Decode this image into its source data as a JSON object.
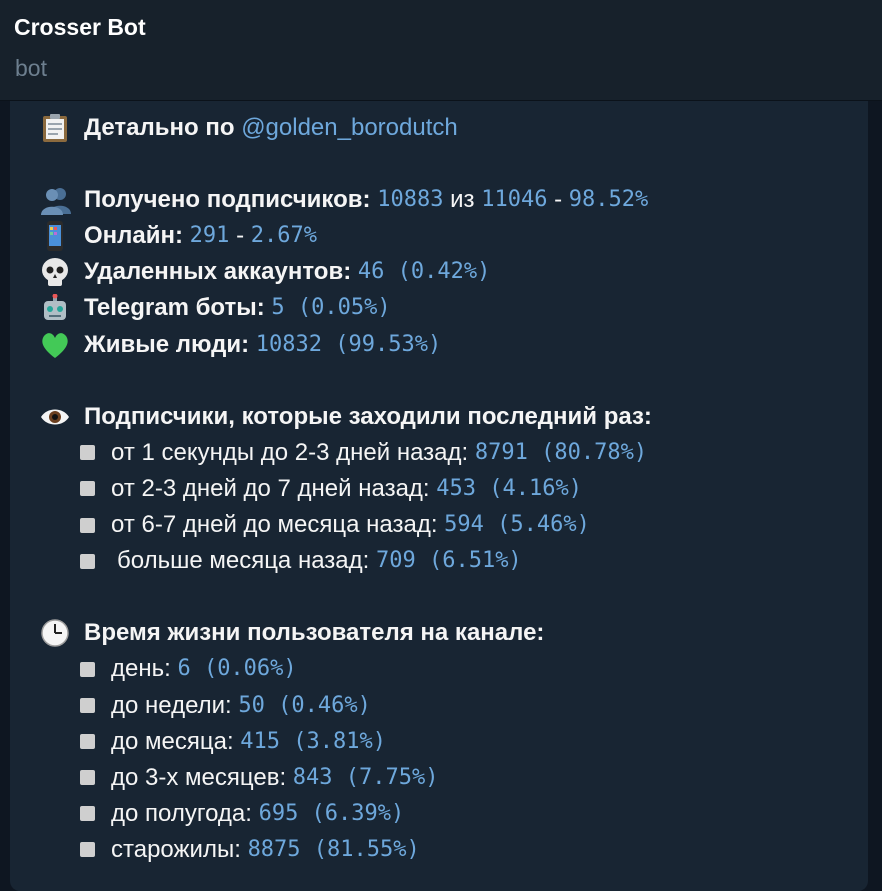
{
  "header": {
    "title": "Crosser Bot",
    "subtitle": "bot"
  },
  "message": {
    "title_prefix": "Детально по",
    "title_link": "@golden_borodutch",
    "stats": {
      "subs_label": "Получено подписчиков:",
      "subs_got": "10883",
      "subs_of": "из",
      "subs_total": "11046",
      "subs_dash": "-",
      "subs_pct": "98.52%",
      "online_label": "Онлайн:",
      "online_val": "291",
      "online_dash": "-",
      "online_pct": "2.67%",
      "deleted_label": "Удаленных аккаунтов:",
      "deleted_val": "46 (0.42%)",
      "bots_label": "Telegram боты:",
      "bots_val": "5 (0.05%)",
      "alive_label": "Живые люди:",
      "alive_val": "10832 (99.53%)"
    },
    "lastseen": {
      "heading": "Подписчики, которые заходили последний раз:",
      "items": [
        {
          "label": "от 1 секунды до 2-3 дней назад:",
          "value": "8791 (80.78%)"
        },
        {
          "label": "от 2-3 дней до 7 дней назад:",
          "value": "453 (4.16%)"
        },
        {
          "label": "от 6-7 дней до месяца назад:",
          "value": "594 (5.46%)"
        },
        {
          "label": "больше месяца назад:",
          "value": "709 (6.51%)"
        }
      ]
    },
    "lifetime": {
      "heading": "Время жизни пользователя на канале:",
      "items": [
        {
          "label": "день:",
          "value": "6 (0.06%)"
        },
        {
          "label": "до недели:",
          "value": "50 (0.46%)"
        },
        {
          "label": "до месяца:",
          "value": "415 (3.81%)"
        },
        {
          "label": "до 3-х месяцев:",
          "value": "843 (7.75%)"
        },
        {
          "label": "до полугода:",
          "value": "695 (6.39%)"
        },
        {
          "label": "старожилы:",
          "value": "8875 (81.55%)"
        }
      ]
    },
    "icons": [
      "clipboard-icon",
      "people-icon",
      "phone-icon",
      "skull-icon",
      "robot-icon",
      "green-heart-icon",
      "eye-icon",
      "clock-icon",
      "square-bullet-icon"
    ]
  }
}
